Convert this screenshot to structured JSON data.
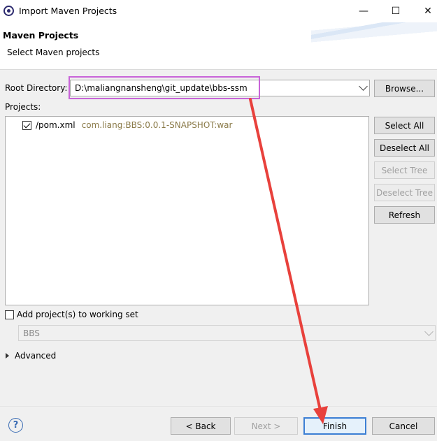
{
  "window": {
    "title": "Import Maven Projects",
    "minimize_glyph": "—",
    "maximize_glyph": "☐",
    "close_glyph": "✕"
  },
  "header": {
    "title": "Maven Projects",
    "subtitle": "Select Maven projects"
  },
  "root_directory": {
    "label": "Root Directory:",
    "value": "D:\\maliangnansheng\\git_update\\bbs-ssm",
    "browse_label": "Browse..."
  },
  "projects": {
    "label": "Projects:",
    "items": [
      {
        "checked": true,
        "name": "/pom.xml",
        "coordinates": "com.liang:BBS:0.0.1-SNAPSHOT:war"
      }
    ]
  },
  "side_buttons": {
    "select_all": "Select All",
    "deselect_all": "Deselect All",
    "select_tree": "Select Tree",
    "deselect_tree": "Deselect Tree",
    "refresh": "Refresh"
  },
  "working_set": {
    "label": "Add project(s) to working set",
    "checked": false,
    "value": "BBS"
  },
  "advanced": {
    "label": "Advanced"
  },
  "footer": {
    "help_glyph": "?",
    "back_label": "< Back",
    "next_label": "Next >",
    "finish_label": "Finish",
    "cancel_label": "Cancel"
  },
  "colors": {
    "highlight": "#c864d8",
    "arrow": "#e8413c",
    "accent": "#3c7fd4",
    "coordinates_text": "#8a7a48"
  },
  "icons": {
    "app": "eclipse-icon",
    "help": "help-icon",
    "dropdown": "chevron-down-icon",
    "expand": "triangle-right-icon",
    "checkbox": "checkbox-icon"
  }
}
